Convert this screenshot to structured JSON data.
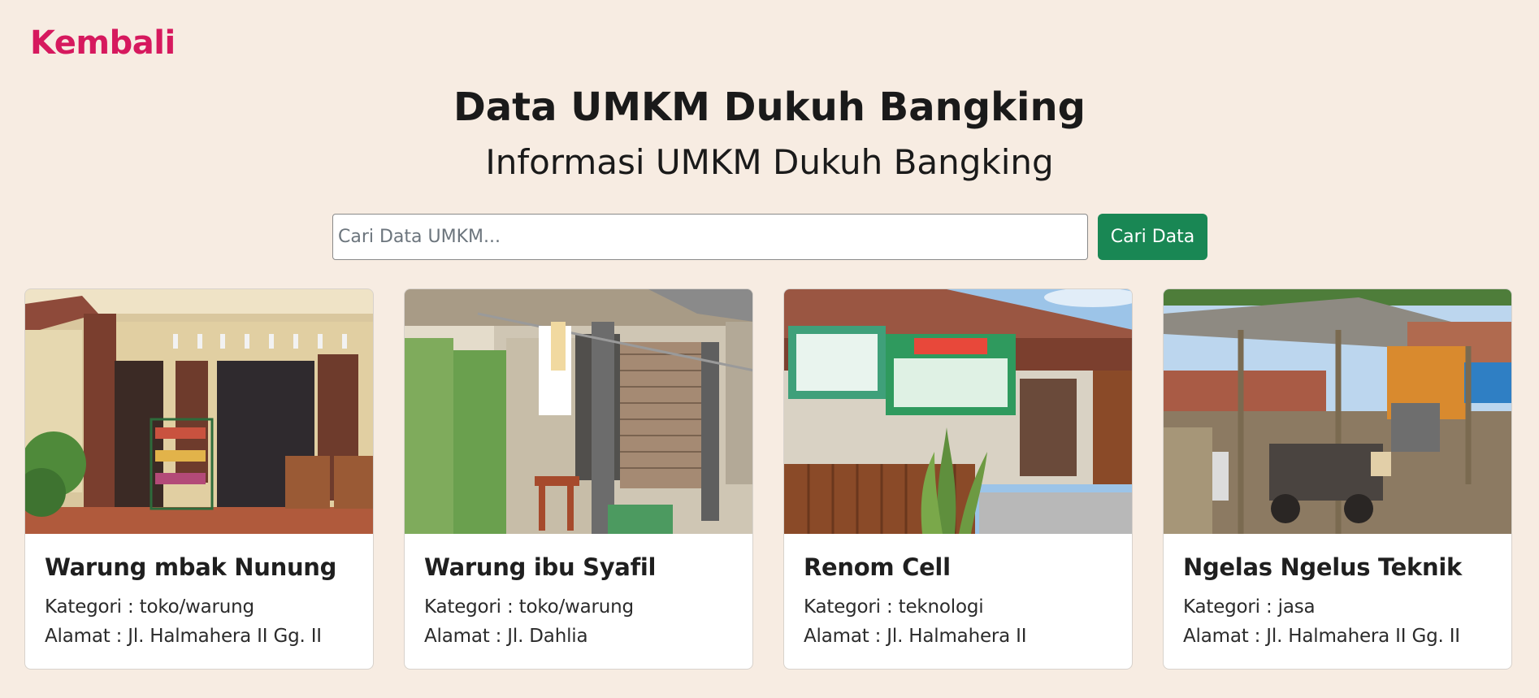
{
  "nav": {
    "back_label": "Kembali"
  },
  "header": {
    "title": "Data UMKM Dukuh Bangking",
    "subtitle": "Informasi UMKM Dukuh Bangking"
  },
  "search": {
    "placeholder": "Cari Data UMKM...",
    "value": "",
    "button_label": "Cari Data"
  },
  "colors": {
    "background": "#f7ece2",
    "accent": "#d6195e",
    "button": "#198754"
  },
  "cards": [
    {
      "name": "Warung mbak Nunung",
      "category": "Kategori : toko/warung",
      "address": "Alamat : Jl. Halmahera II Gg. II"
    },
    {
      "name": "Warung ibu Syafil",
      "category": "Kategori : toko/warung",
      "address": "Alamat : Jl. Dahlia"
    },
    {
      "name": "Renom Cell",
      "category": "Kategori : teknologi",
      "address": "Alamat : Jl. Halmahera II"
    },
    {
      "name": "Ngelas Ngelus Teknik",
      "category": "Kategori : jasa",
      "address": "Alamat : Jl. Halmahera II Gg. II"
    }
  ]
}
